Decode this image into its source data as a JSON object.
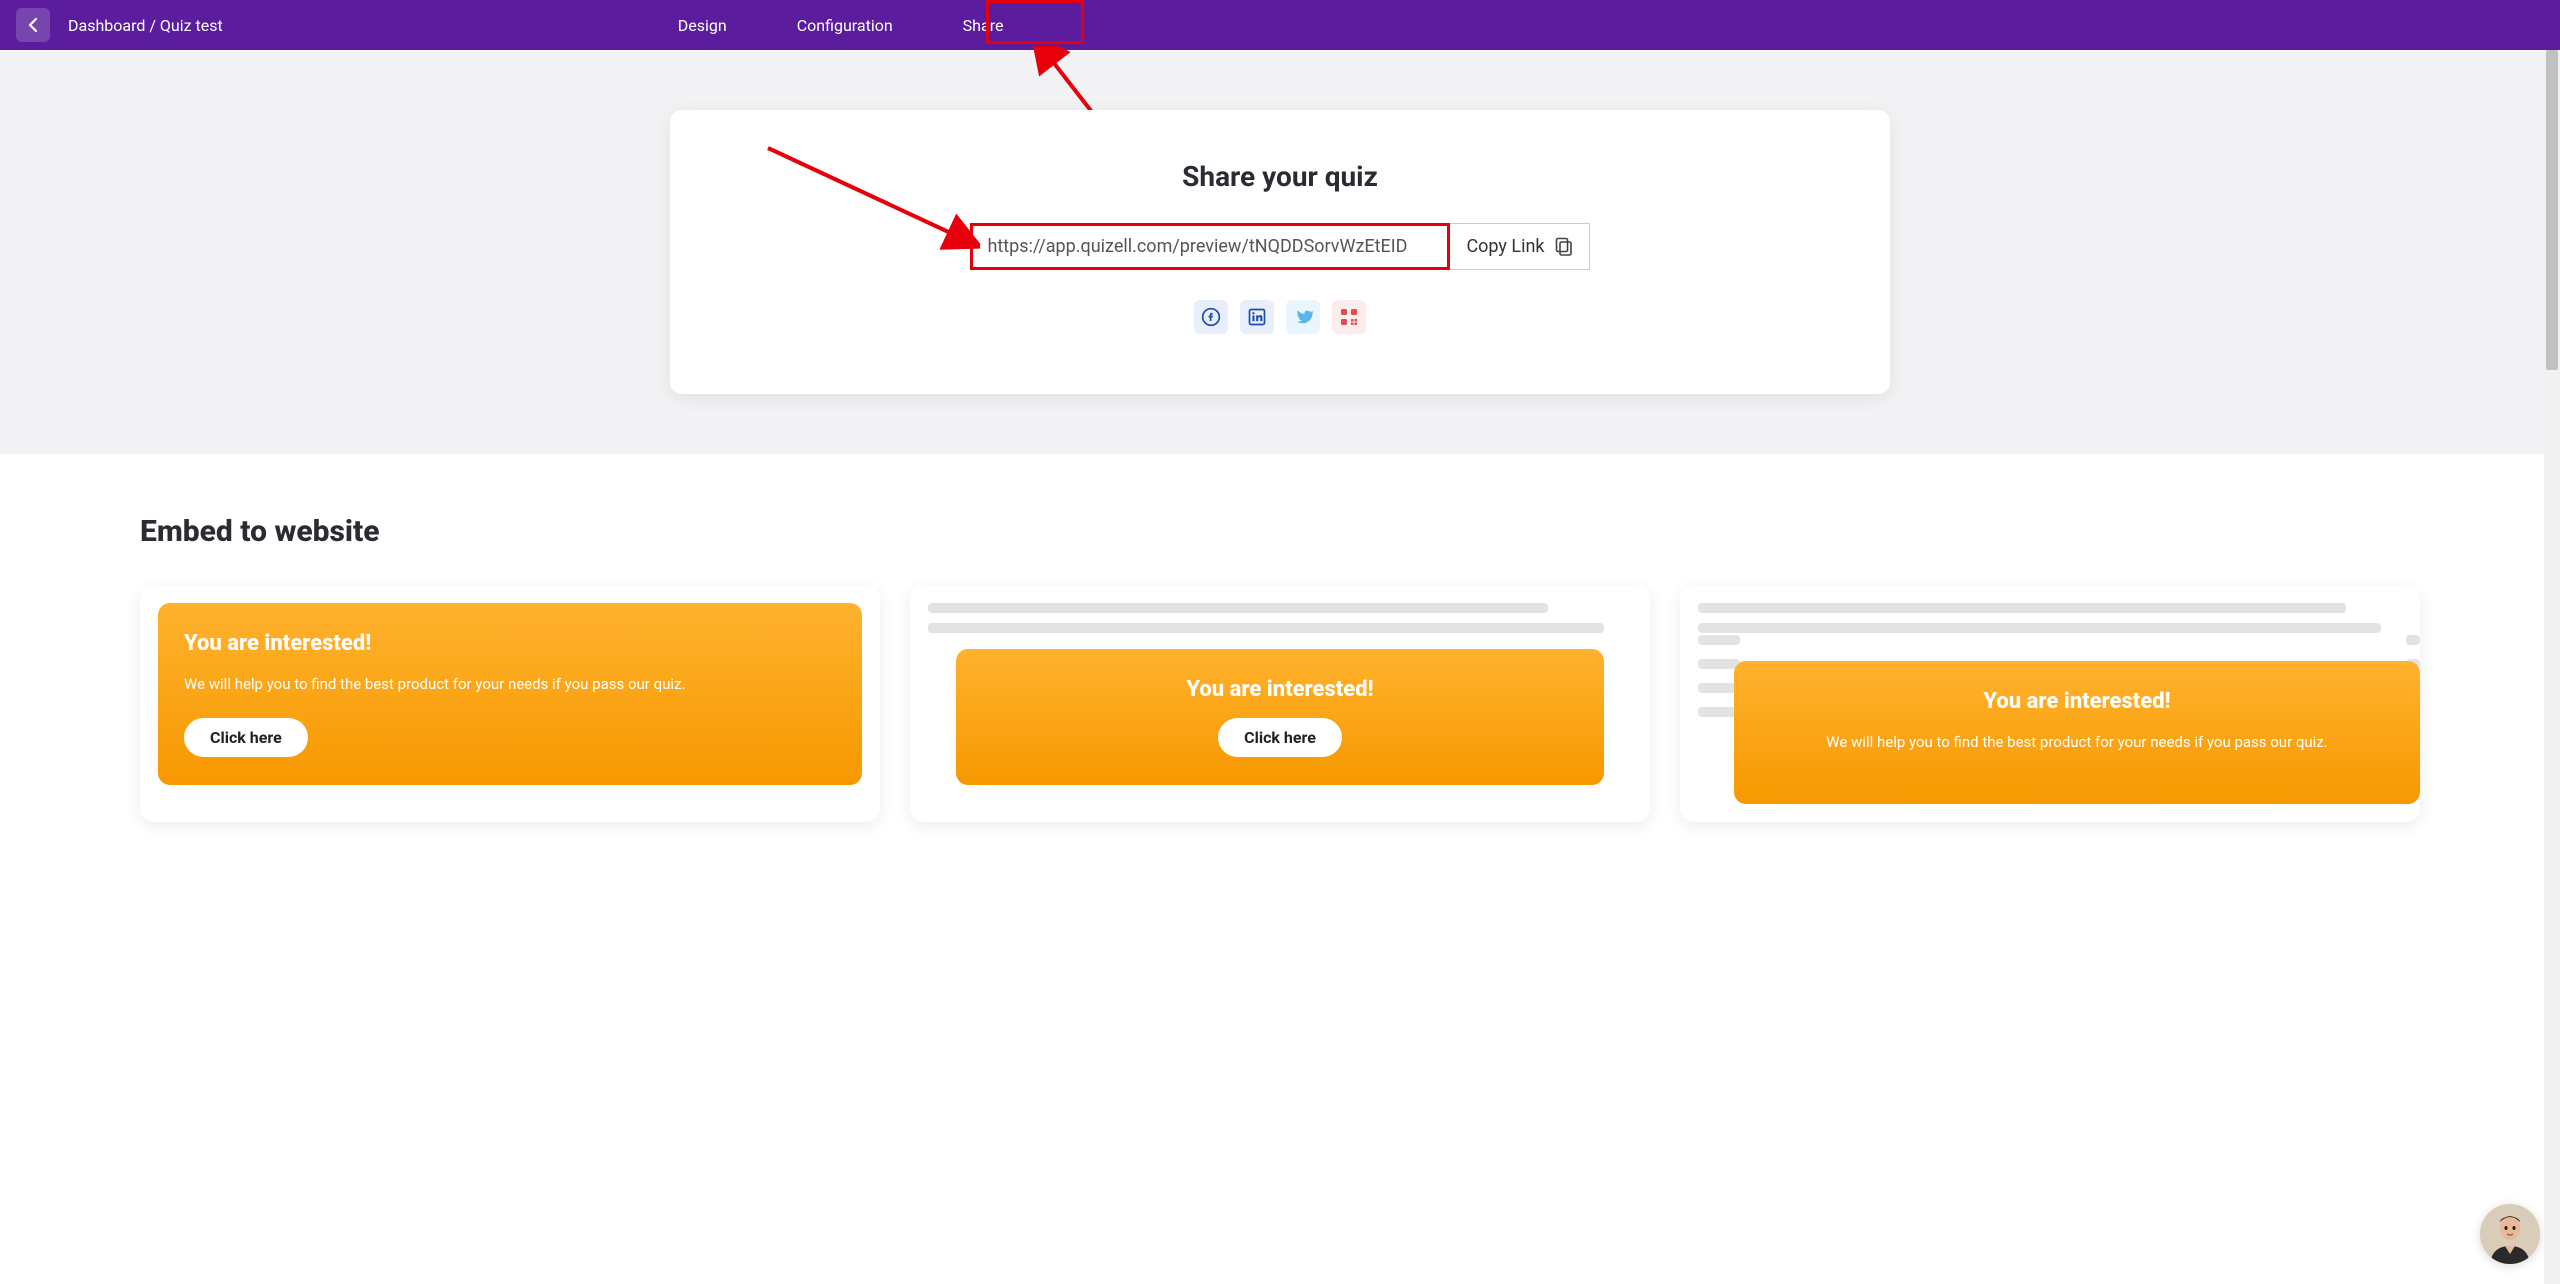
{
  "header": {
    "breadcrumb": "Dashboard / Quiz test",
    "tabs": [
      "Design",
      "Configuration",
      "Share"
    ]
  },
  "share": {
    "title": "Share your quiz",
    "url": "https://app.quizell.com/preview/tNQDDSorvWzEtEID",
    "copy_label": "Copy Link",
    "social": {
      "facebook": "facebook-icon",
      "linkedin": "linkedin-icon",
      "twitter": "twitter-icon",
      "qr": "qr-icon"
    }
  },
  "embed": {
    "title": "Embed to website",
    "cards": [
      {
        "heading": "You are interested!",
        "desc": "We will help you to find the best product for your needs if you pass our quiz.",
        "button": "Click here"
      },
      {
        "heading": "You are interested!",
        "desc": "",
        "button": "Click here"
      },
      {
        "heading": "You are interested!",
        "desc": "We will help you to find the best product for your needs if you pass our quiz.",
        "button": ""
      }
    ]
  },
  "colors": {
    "brand": "#5b1d9e",
    "annotation_red": "#e7000b",
    "orange_top": "#ffb22e",
    "orange_bottom": "#f79800"
  }
}
